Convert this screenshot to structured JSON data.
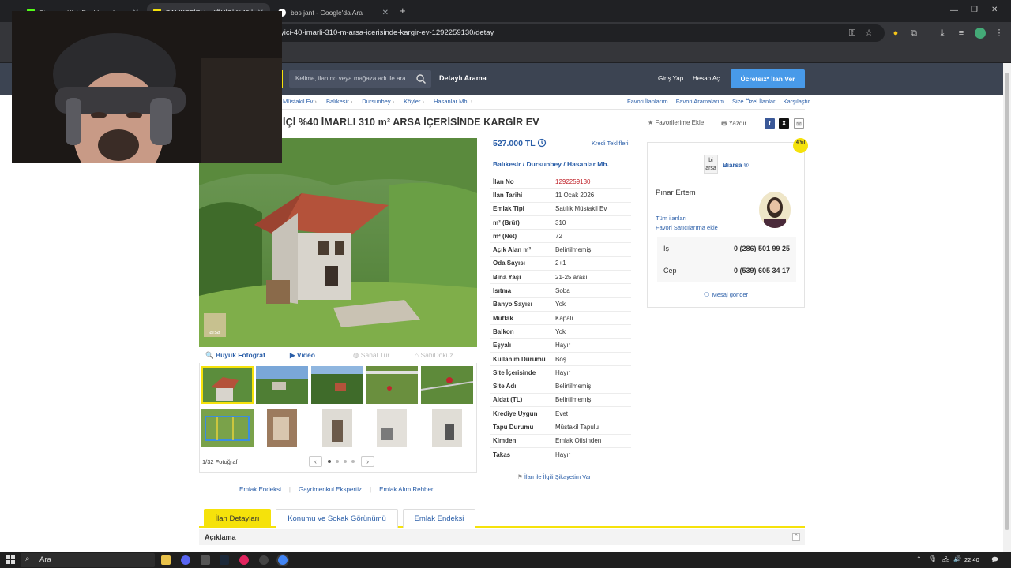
{
  "browser": {
    "tabs": [
      {
        "label": "Stream - Kick Dashboard",
        "favicon_color": "#53fc18"
      },
      {
        "label": "BALIKESİR'de KÖYİÇİ %40 İMAR",
        "favicon_color": "#f5e20b"
      },
      {
        "label": "bbs jant - Google'da Ara",
        "favicon_color": "#ffffff"
      }
    ],
    "url": "yici-40-imarli-310-m-arsa-icerisinde-kargir-ev-1292259130/detay"
  },
  "site": {
    "search_placeholder": "Kelime, ilan no veya mağaza adı ile ara",
    "detailed_search": "Detaylı Arama",
    "login": "Giriş Yap",
    "register": "Hesap Aç",
    "post_ad": "Ücretsiz* İlan Ver"
  },
  "breadcrumb": [
    "Müstakil Ev",
    "Balıkesir",
    "Dursunbey",
    "Köyler",
    "Hasanlar Mh."
  ],
  "top_links": [
    "Favori İlanlarım",
    "Favori Aramalarım",
    "Size Özel İlanlar",
    "Karşılaştır"
  ],
  "listing": {
    "title": "İÇİ %40 İMARLI 310 m² ARSA İÇERİSİNDE KARGİR EV",
    "add_favorite": "Favorilerime Ekle",
    "print": "Yazdır",
    "price": "527.000 TL",
    "credit_offers": "Kredi Teklifleri",
    "location": "Balıkesir  /  Dursunbey  /  Hasanlar Mh.",
    "attributes": [
      {
        "key": "İlan No",
        "value": "1292259130"
      },
      {
        "key": "İlan Tarihi",
        "value": "11 Ocak 2026"
      },
      {
        "key": "Emlak Tipi",
        "value": "Satılık Müstakil Ev"
      },
      {
        "key": "m² (Brüt)",
        "value": "310"
      },
      {
        "key": "m² (Net)",
        "value": "72"
      },
      {
        "key": "Açık Alan m²",
        "value": "Belirtilmemiş"
      },
      {
        "key": "Oda Sayısı",
        "value": "2+1"
      },
      {
        "key": "Bina Yaşı",
        "value": "21-25 arası"
      },
      {
        "key": "Isıtma",
        "value": "Soba"
      },
      {
        "key": "Banyo Sayısı",
        "value": "Yok"
      },
      {
        "key": "Mutfak",
        "value": "Kapalı"
      },
      {
        "key": "Balkon",
        "value": "Yok"
      },
      {
        "key": "Eşyalı",
        "value": "Hayır"
      },
      {
        "key": "Kullanım Durumu",
        "value": "Boş"
      },
      {
        "key": "Site İçerisinde",
        "value": "Hayır"
      },
      {
        "key": "Site Adı",
        "value": "Belirtilmemiş"
      },
      {
        "key": "Aidat (TL)",
        "value": "Belirtilmemiş"
      },
      {
        "key": "Krediye Uygun",
        "value": "Evet"
      },
      {
        "key": "Tapu Durumu",
        "value": "Müstakil Tapulu"
      },
      {
        "key": "Kimden",
        "value": "Emlak Ofisinden"
      },
      {
        "key": "Takas",
        "value": "Hayır"
      }
    ],
    "complaint": "İlan ile İlgili Şikayetim Var"
  },
  "photos": {
    "big_photo": "Büyük Fotoğraf",
    "video": "Video",
    "virtual_tour": "Sanal Tur",
    "sahibinden_tour": "SahiDokuz",
    "count": "1/32 Fotoğraf",
    "watermark": "arsa"
  },
  "seller": {
    "store": "Biarsa",
    "store_logo": "bi arsa",
    "name": "Pınar Ertem",
    "all_ads": "Tüm ilanları",
    "favorite_seller": "Favori Satıcılarıma ekle",
    "phones": [
      {
        "label": "İş",
        "number": "0 (286) 501 99 25"
      },
      {
        "label": "Cep",
        "number": "0 (539) 605 34 17"
      }
    ],
    "message": "Mesaj gönder",
    "badge": "4 Yıl"
  },
  "bottom_links": [
    "Emlak Endeksi",
    "Gayrimenkul Ekspertiz",
    "Emlak Alım Rehberi"
  ],
  "page_tabs": [
    "İlan Detayları",
    "Konumu ve Sokak Görünümü",
    "Emlak Endeksi"
  ],
  "description_title": "Açıklama",
  "taskbar": {
    "search": "Ara",
    "clock": "22:40"
  },
  "colors": {
    "accent_blue": "#2a5ea8",
    "brand_yellow": "#f5e20b",
    "header_bg": "#3c4452",
    "cta_blue": "#489ae9"
  }
}
